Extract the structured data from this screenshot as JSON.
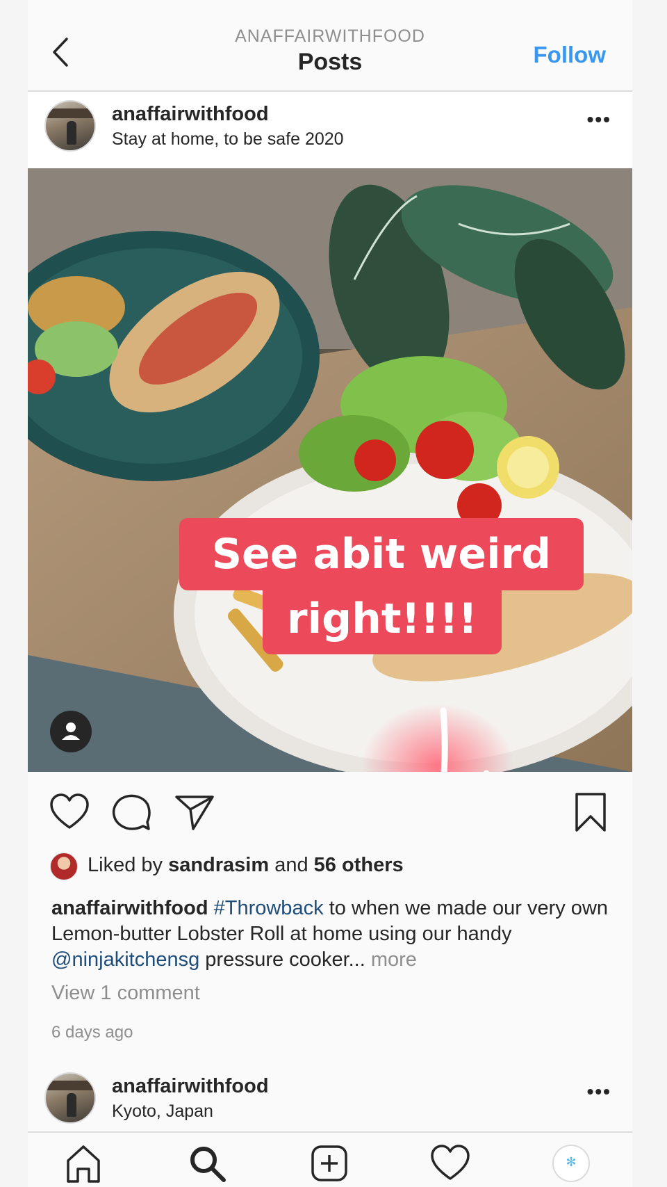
{
  "header": {
    "subtitle": "ANAFFAIRWITHFOOD",
    "title": "Posts",
    "follow_label": "Follow"
  },
  "post": {
    "username": "anaffairwithfood",
    "location": "Stay at home, to be safe 2020",
    "more_icon": "more-dots-icon",
    "sticker_line1": "See abit weird",
    "sticker_line2": "right!!!!",
    "liked_prefix": "Liked by",
    "liked_user": "sandrasim",
    "liked_and": "and",
    "liked_others": "56 others",
    "caption": {
      "author": "anaffairwithfood",
      "hashtag": "#Throwback",
      "part1": "to when we made our very own Lemon-butter Lobster Roll at home using our handy",
      "mention": "@ninjakitchensg",
      "part2": "pressure cooker...",
      "more": "more"
    },
    "view_comments": "View 1 comment",
    "time_ago": "6 days ago"
  },
  "next_post": {
    "username": "anaffairwithfood",
    "location": "Kyoto, Japan"
  },
  "icons": {
    "back": "chevron-left-icon",
    "like": "heart-icon",
    "comment": "comment-icon",
    "share": "paper-plane-icon",
    "save": "bookmark-icon",
    "tag": "person-tag-icon",
    "home": "home-icon",
    "search": "search-icon",
    "new_post": "plus-square-icon",
    "activity": "heart-icon",
    "profile": "profile-avatar-icon"
  },
  "colors": {
    "follow_blue": "#3897f0",
    "sticker_red": "#ec4a5a",
    "link_blue": "#1f4d7a",
    "muted_gray": "#8e8e8e"
  }
}
